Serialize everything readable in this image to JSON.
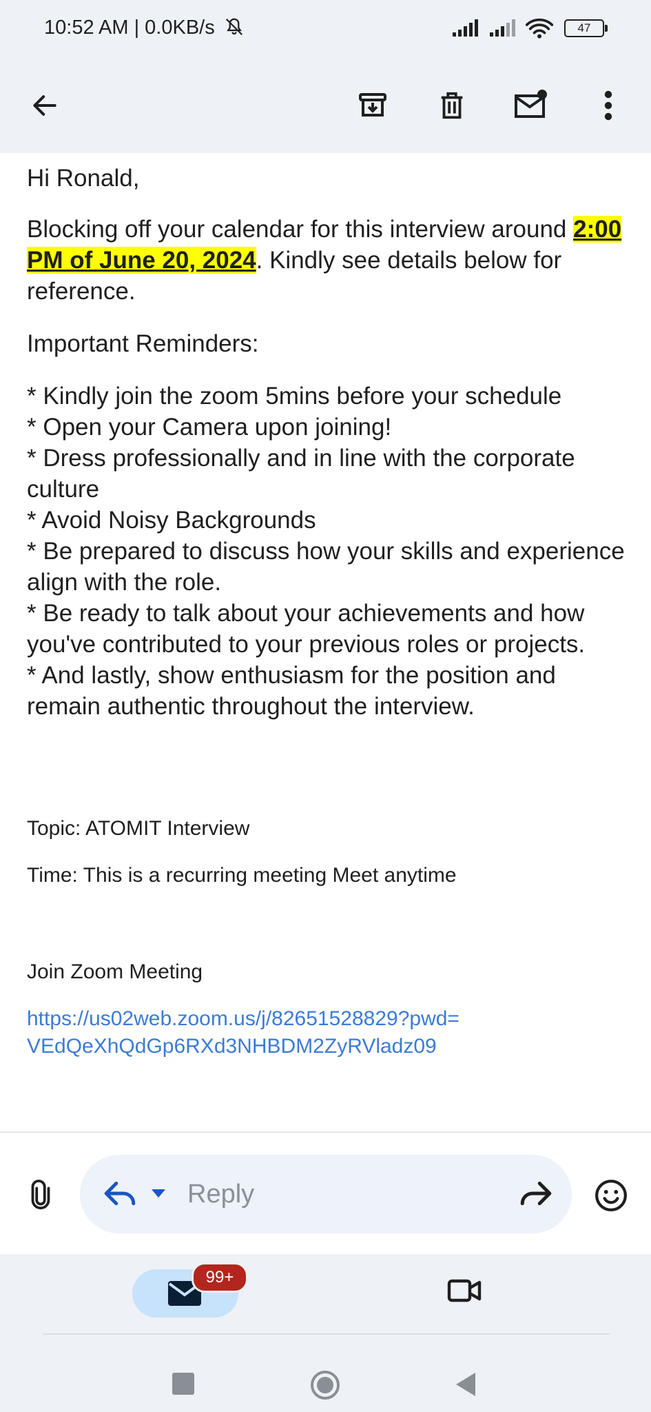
{
  "status": {
    "time": "10:52 AM | 0.0KB/s",
    "battery": "47"
  },
  "toolbar": {
    "back_icon": "arrow-back-icon",
    "archive_icon": "archive-icon",
    "delete_icon": "trash-icon",
    "unread_icon": "mark-unread-icon",
    "more_icon": "more-vert-icon"
  },
  "email": {
    "greeting": "Hi Ronald,",
    "para1_before": "Blocking off your calendar for this interview around ",
    "para1_highlight": "2:00 PM of June 20, 2024",
    "para1_after": ". Kindly see details below for reference.",
    "reminders_title": "Important Reminders:",
    "reminders": [
      "* Kindly join the zoom 5mins before your schedule",
      "* Open your Camera upon joining!",
      "* Dress professionally and in line with the corporate culture",
      "* Avoid Noisy Backgrounds",
      "* Be prepared to discuss how your skills and experience align with the role.",
      "* Be ready to talk about your achievements and how you've contributed to your previous roles or projects.",
      "* And lastly, show enthusiasm for the position and remain authentic throughout the interview."
    ],
    "topic": "Topic: ATOMIT Interview",
    "time": "Time: This is a recurring meeting Meet anytime",
    "join": "Join Zoom Meeting",
    "link_line1": "https://us02web.zoom.us/j/82651528829?pwd=",
    "link_line2": "VEdQeXhQdGp6RXd3NHBDM2ZyRVladz09"
  },
  "reply": {
    "label": "Reply"
  },
  "nav": {
    "mail_badge": "99+"
  },
  "colors": {
    "accent": "#1a56c4",
    "link": "#3c7bd6",
    "highlight": "#ffff00",
    "badge": "#b3261e"
  }
}
